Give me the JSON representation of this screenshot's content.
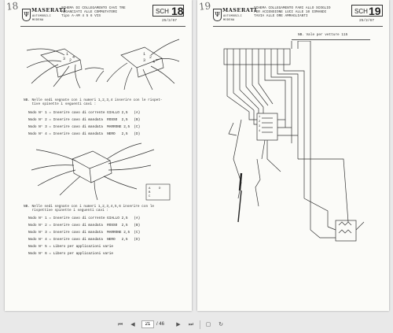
{
  "left_page": {
    "page_scrawl": "18",
    "logo": {
      "brand": "MASERATI",
      "sub1": "AUTOMOBILI",
      "sub2": "MODENA"
    },
    "header_title": "SCHEMA DI COLLEGAMENTO CAVI TRE\nAGGANCIATI ALLE COMMUTATORI\nTipo A-AM 4 5 6 VIS",
    "sch_label": "SCH",
    "sch_number": "18",
    "date": "25/2/67",
    "intro1": "NB. Nelle sedi segnate con i numeri 1,2,3,4 inserire con le rispet-\n    tive spinette i seguenti cavi :",
    "list1": [
      "Nodo N° 1 = Inserire cavo di corrente GIALLO 2,5   (A)",
      "Nodo N° 2 = Inserire cavo di mandata  ROSSO  2,5   (B)",
      "Nodo N° 3 = Inserire cavo di mandata  MARRONE 2,5  (C)",
      "Nodo N° 4 = Inserire cavo di mandata  NERO   2,5   (D)"
    ],
    "intro2": "NB. Nelle sedi segnate con i numeri 1,2,3,4,5,6 inserire con le\n    rispettive spinette i seguenti cavi :",
    "list2": [
      "Nodo N° 1 = Inserire cavo di corrente GIALLO 2,5   (A)",
      "Nodo N° 2 = Inserire cavo di mandata  ROSSO  2,5   (B)",
      "Nodo N° 3 = Inserire cavo di mandata  MARRONE 2,5  (C)",
      "Nodo N° 4 = Inserire cavo di mandata  NERO   2,5   (D)",
      "Nodo N° 5 = Libero per applicazioni varie",
      "Nodo N° 6 = Libero per applicazioni varie"
    ],
    "callout": [
      "A",
      "B",
      "C",
      "D"
    ]
  },
  "right_page": {
    "page_scrawl": "19",
    "logo": {
      "brand": "MASERATI",
      "sub1": "AUTOMOBILI",
      "sub2": "MODENA"
    },
    "header_title": "SCHEMA COLLEGAMENTO FARI ALLO SCOGLIO\nPER ACCENSIONE LUCI ALLE 10 COMANDI\nTAVIA ALLE ORE AMMAGLIANTI",
    "sch_label": "SCH",
    "sch_number": "19",
    "date": "25/2/67",
    "note": "NB. Vale per vetture 115"
  },
  "toolbar": {
    "current_page": "21",
    "total_pages": "/ 46",
    "icons": [
      "first-page-icon",
      "prev-page-icon",
      "next-page-icon",
      "last-page-icon",
      "fit-page-icon",
      "rotate-icon"
    ]
  }
}
